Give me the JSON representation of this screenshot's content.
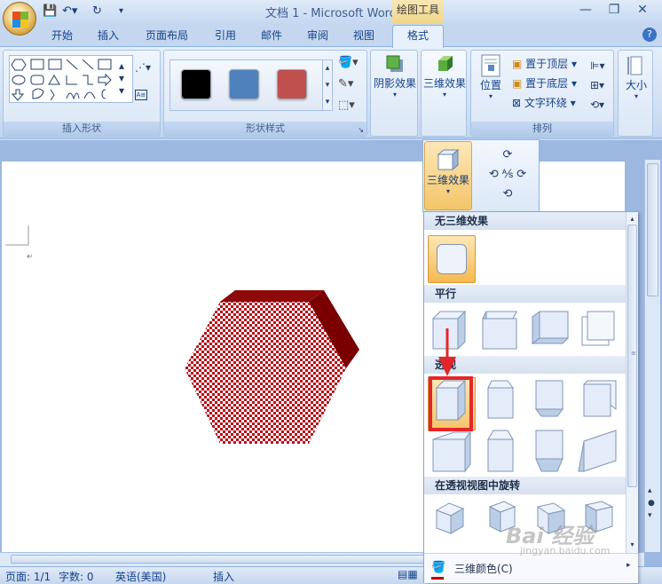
{
  "window": {
    "title": "文档 1 - Microsoft Word",
    "context_tool": "绘图工具"
  },
  "tabs": [
    "开始",
    "插入",
    "页面布局",
    "引用",
    "邮件",
    "审阅",
    "视图",
    "格式"
  ],
  "groups": {
    "insert_shapes": "插入形状",
    "shape_styles": "形状样式",
    "arrange": "排列"
  },
  "buttons": {
    "shadow": "阴影效果",
    "effects3d": "三维效果",
    "position": "位置",
    "bring_front": "置于顶层",
    "send_back": "置于底层",
    "text_wrap": "文字环绕",
    "size": "大小"
  },
  "callout": {
    "label": "三维效果"
  },
  "gallery": {
    "no_effect": "无三维效果",
    "parallel": "平行",
    "perspective": "透视",
    "rotate_perspective": "在透视视图中旋转",
    "color": "三维颜色(C)"
  },
  "status": {
    "page": "页面: 1/1",
    "words": "字数: 0",
    "lang": "英语(美国)",
    "mode": "插入"
  },
  "swatches": [
    "#000000",
    "#4f81bd",
    "#c0504d"
  ],
  "accent": "#e4262a",
  "watermark": {
    "brand": "Bai 经验",
    "url": "jingyan.baidu.com"
  }
}
